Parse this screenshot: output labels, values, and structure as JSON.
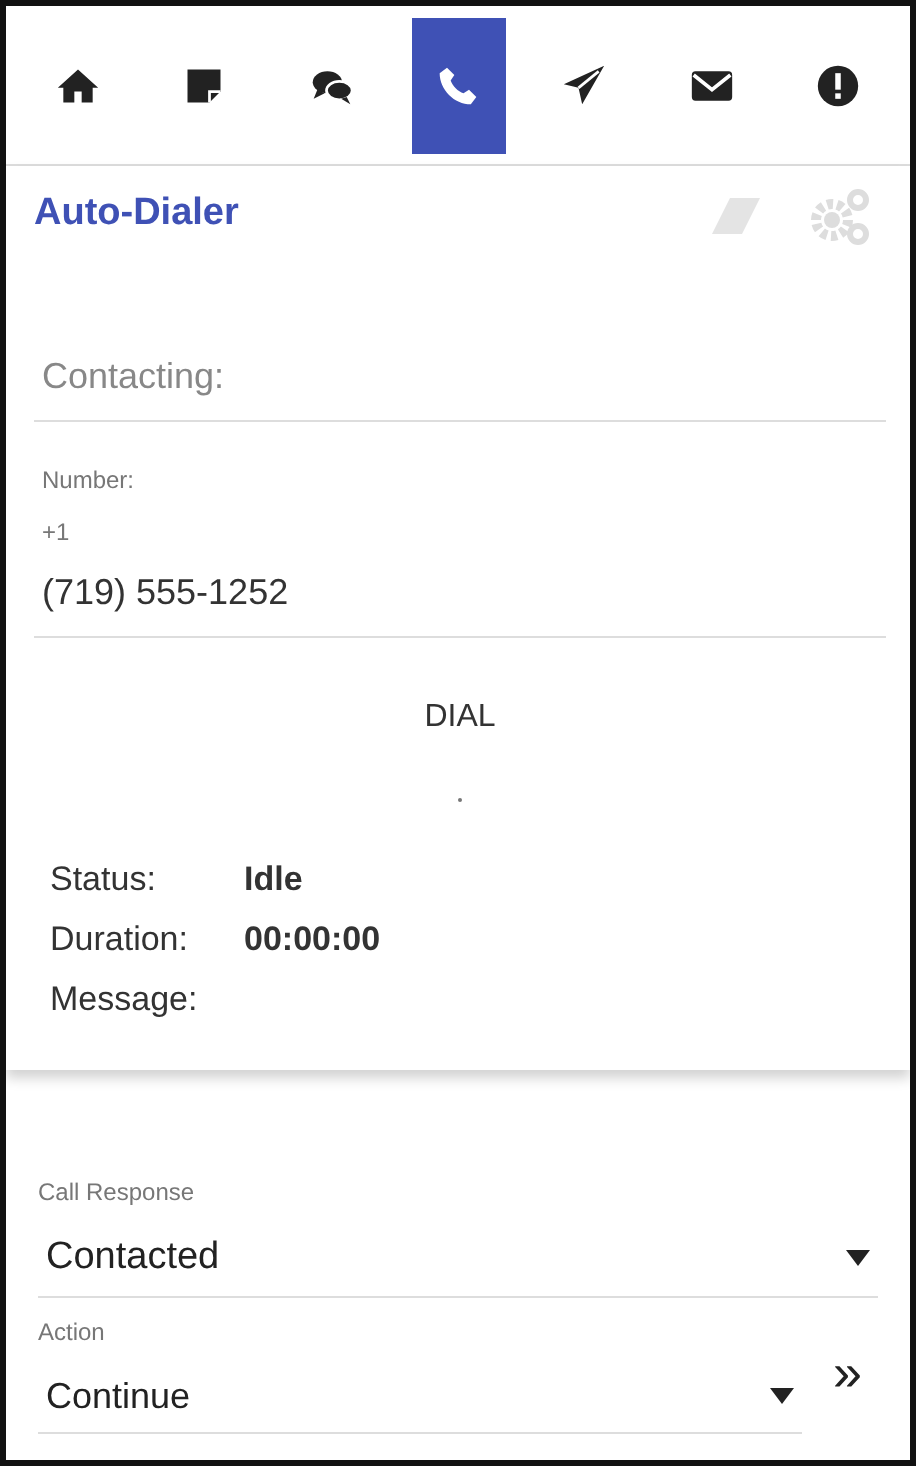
{
  "tabs": [
    {
      "selected": false
    },
    {
      "selected": false
    },
    {
      "selected": false
    },
    {
      "selected": true
    },
    {
      "selected": false
    },
    {
      "selected": false
    },
    {
      "selected": false
    }
  ],
  "panel": {
    "title": "Auto-Dialer"
  },
  "contacting": {
    "placeholder": "Contacting:"
  },
  "number": {
    "label": "Number:",
    "prefix": "+1",
    "value": "(719) 555-1252"
  },
  "dial_button": "DIAL",
  "details": [
    {
      "label": "Status:",
      "value": "Idle"
    },
    {
      "label": "Duration:",
      "value": "00:00:00"
    },
    {
      "label": "Message:"
    }
  ],
  "call_response": {
    "label": "Call Response",
    "value": "Contacted"
  },
  "action": {
    "label": "Action",
    "value": "Continue"
  },
  "next_button": "»"
}
